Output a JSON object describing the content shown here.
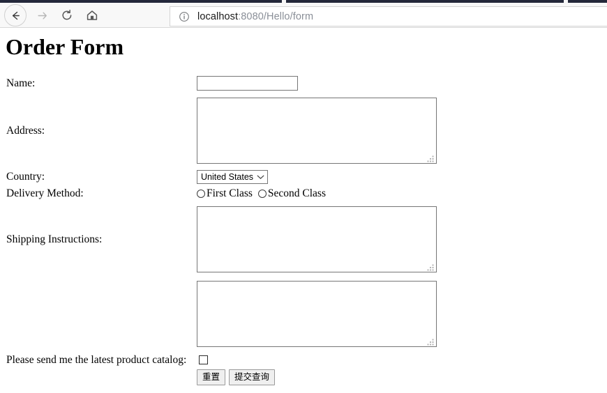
{
  "browser": {
    "back_icon": "arrow-left-icon",
    "forward_icon": "arrow-right-icon",
    "reload_icon": "reload-icon",
    "home_icon": "home-icon",
    "site_info_icon": "info-circle-icon",
    "url_host": "localhost",
    "url_path": ":8080/Hello/form",
    "url_full": "localhost:8080/Hello/form",
    "top_strip_color": "#24283b",
    "toolbar_bg": "#f8f8f8"
  },
  "page": {
    "title": "Order Form"
  },
  "form": {
    "rows": [
      {
        "label": "Name:"
      },
      {
        "label": "Address:"
      },
      {
        "label": "Country:"
      },
      {
        "label": "Delivery Method:"
      },
      {
        "label": "Shipping Instructions:"
      }
    ],
    "name": {
      "label": "Name:",
      "value": "",
      "placeholder": ""
    },
    "address": {
      "label": "Address:",
      "value": "",
      "placeholder": ""
    },
    "country": {
      "label": "Country:",
      "selected": "United States",
      "chevron_icon": "chevron-down-icon",
      "options": [
        "United States"
      ]
    },
    "delivery": {
      "label": "Delivery Method:",
      "options": [
        {
          "label": "First Class",
          "checked": false
        },
        {
          "label": "Second Class",
          "checked": false
        }
      ]
    },
    "shipping": {
      "label": "Shipping Instructions:",
      "value": "",
      "placeholder": ""
    },
    "extra": {
      "label": "",
      "value": "",
      "placeholder": ""
    },
    "catalog": {
      "label": "Please send me the latest product catalog:",
      "checked": false
    },
    "buttons": {
      "reset_label": "重置",
      "submit_label": "提交查询"
    }
  },
  "colors": {
    "field_border": "#767676",
    "button_bg": "#efefef",
    "button_border": "#9a9a9a",
    "url_path_gray": "#8a8f98"
  }
}
